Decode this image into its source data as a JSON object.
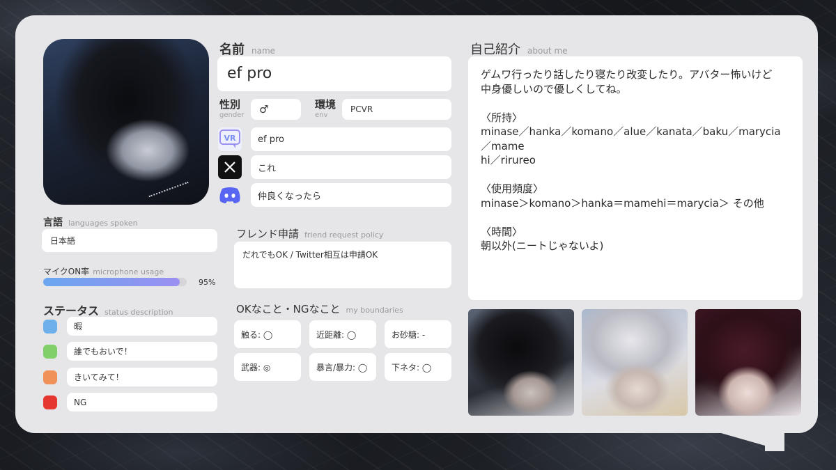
{
  "profile": {
    "name_label": "名前",
    "name_label_en": "name",
    "name": "ef pro",
    "gender_label": "性別",
    "gender_label_en": "gender",
    "gender": "♂",
    "env_label": "環境",
    "env_label_en": "env",
    "env": "PCVR"
  },
  "accounts": [
    {
      "icon": "vrchat-icon",
      "value": "ef pro"
    },
    {
      "icon": "x-icon",
      "value": "これ"
    },
    {
      "icon": "discord-icon",
      "value": "仲良くなったら"
    }
  ],
  "language": {
    "label": "言語",
    "label_en": "languages spoken",
    "value": "日本語"
  },
  "mic": {
    "label": "マイクON率",
    "label_en": "microphone usage",
    "percent_text": "95%",
    "fraction": 0.95
  },
  "status": {
    "label": "ステータス",
    "label_en": "status description",
    "items": [
      {
        "color": "#6fb0ea",
        "text": "暇"
      },
      {
        "color": "#7fd06a",
        "text": "誰でもおいで！"
      },
      {
        "color": "#f0915a",
        "text": "きいてみて！"
      },
      {
        "color": "#e5372f",
        "text": "NG"
      }
    ]
  },
  "friend": {
    "label": "フレンド申請",
    "label_en": "friend request policy",
    "value": "だれでもOK / Twitter相互は申請OK"
  },
  "boundaries": {
    "label": "OKなこと・NGなこと",
    "label_en": "my boundaries",
    "items": [
      "触る: ◯",
      "近距離: ◯",
      "お砂糖: -",
      "武器: ◎",
      "暴言/暴力: ◯",
      "下ネタ: ◯"
    ]
  },
  "about": {
    "label": "自己紹介",
    "label_en": "about me",
    "text": "ゲムワ行ったり話したり寝たり改変したり。アバター怖いけど\n中身優しいので優しくしてね。\n\n〈所持〉\nminase／hanka／komano／alue／kanata／baku／marycia／mame\nhi／rirureo\n\n〈使用頻度〉\nminase＞komano＞hanka＝mamehi＝marycia＞ その他\n\n〈時間〉\n朝以外(ニートじゃないよ)"
  },
  "colors": {
    "card": "#e6e6e8",
    "accent_blue": "#6aa6f0",
    "accent_purple": "#9b8ff2",
    "discord": "#5865f2"
  }
}
